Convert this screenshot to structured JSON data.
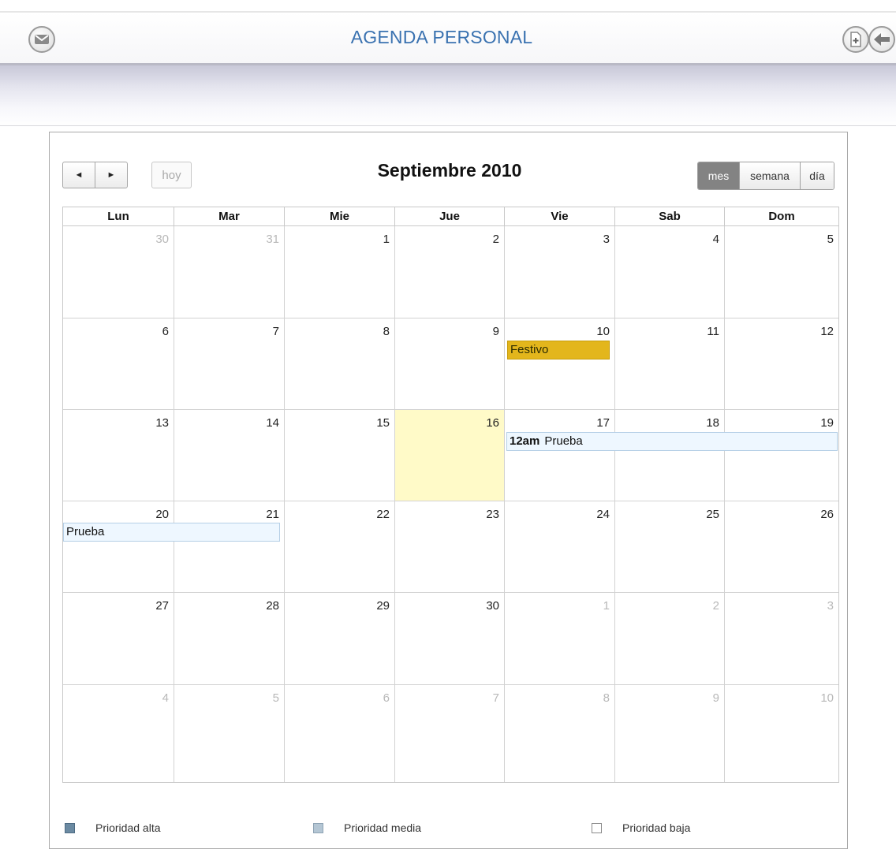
{
  "header": {
    "title": "AGENDA PERSONAL",
    "mail_icon": "mail-icon",
    "new_icon": "new-document-icon",
    "back_icon": "back-arrow-icon"
  },
  "calendar": {
    "month_title": "Septiembre 2010",
    "prev_label": "◄",
    "next_label": "►",
    "today_label": "hoy",
    "views": [
      {
        "label": "mes",
        "active": true
      },
      {
        "label": "semana",
        "active": false
      },
      {
        "label": "día",
        "active": false
      }
    ],
    "weekdays": [
      "Lun",
      "Mar",
      "Mie",
      "Jue",
      "Vie",
      "Sab",
      "Dom"
    ],
    "weeks": [
      [
        {
          "d": "30",
          "o": true
        },
        {
          "d": "31",
          "o": true
        },
        {
          "d": "1"
        },
        {
          "d": "2"
        },
        {
          "d": "3"
        },
        {
          "d": "4"
        },
        {
          "d": "5"
        }
      ],
      [
        {
          "d": "6"
        },
        {
          "d": "7"
        },
        {
          "d": "8"
        },
        {
          "d": "9"
        },
        {
          "d": "10"
        },
        {
          "d": "11"
        },
        {
          "d": "12"
        }
      ],
      [
        {
          "d": "13"
        },
        {
          "d": "14"
        },
        {
          "d": "15"
        },
        {
          "d": "16",
          "today": true
        },
        {
          "d": "17"
        },
        {
          "d": "18"
        },
        {
          "d": "19"
        }
      ],
      [
        {
          "d": "20"
        },
        {
          "d": "21"
        },
        {
          "d": "22"
        },
        {
          "d": "23"
        },
        {
          "d": "24"
        },
        {
          "d": "25"
        },
        {
          "d": "26"
        }
      ],
      [
        {
          "d": "27"
        },
        {
          "d": "28"
        },
        {
          "d": "29"
        },
        {
          "d": "30"
        },
        {
          "d": "1",
          "o": true
        },
        {
          "d": "2",
          "o": true
        },
        {
          "d": "3",
          "o": true
        }
      ],
      [
        {
          "d": "4",
          "o": true
        },
        {
          "d": "5",
          "o": true
        },
        {
          "d": "6",
          "o": true
        },
        {
          "d": "7",
          "o": true
        },
        {
          "d": "8",
          "o": true
        },
        {
          "d": "9",
          "o": true
        },
        {
          "d": "10",
          "o": true
        }
      ]
    ],
    "events": {
      "festivo": {
        "title": "Festivo",
        "color": "#e3b61c"
      },
      "prueba_week3": {
        "time": "12am",
        "title": "Prueba"
      },
      "prueba_week4": {
        "title": "Prueba"
      }
    },
    "today_color": "#fffac8"
  },
  "legend": [
    {
      "label": "Prioridad alta",
      "color": "#6b8aa2"
    },
    {
      "label": "Prioridad media",
      "color": "#b4c6d4"
    },
    {
      "label": "Prioridad baja",
      "color": "#ffffff"
    }
  ]
}
